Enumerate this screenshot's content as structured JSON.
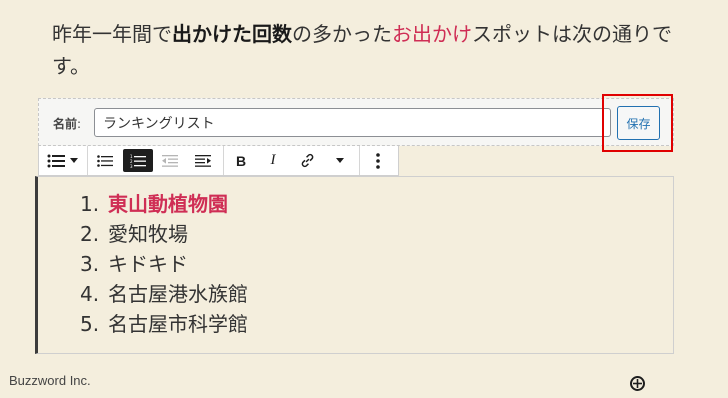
{
  "paragraph": {
    "part1": "昨年一年間で",
    "bold": "出かけた回数",
    "part2": "の多かった",
    "accent": "お出かけ",
    "part3": "スポットは次の通りです。"
  },
  "save_panel": {
    "name_label": "名前",
    "name_value": "ランキングリスト",
    "save_label": "保存"
  },
  "toolbar": {
    "items": [
      "list-icon",
      "chevron-down-icon",
      "unordered-list-icon",
      "ordered-list-icon",
      "outdent-icon",
      "indent-icon",
      "bold-icon",
      "italic-icon",
      "link-icon",
      "chevron-down-icon",
      "more-options-icon"
    ],
    "bold_glyph": "B",
    "italic_glyph": "I"
  },
  "list": {
    "items": [
      {
        "number": "1.",
        "text": "東山動植物園"
      },
      {
        "number": "2.",
        "text": "愛知牧場"
      },
      {
        "number": "3.",
        "text": "キドキド"
      },
      {
        "number": "4.",
        "text": "名古屋港水族館"
      },
      {
        "number": "5.",
        "text": "名古屋市科学館"
      }
    ]
  },
  "footer": {
    "brand": "Buzzword Inc."
  },
  "colors": {
    "background": "#f4eedd",
    "accent": "#cf2e55",
    "button_blue": "#2271b1",
    "highlight": "#e00000"
  }
}
